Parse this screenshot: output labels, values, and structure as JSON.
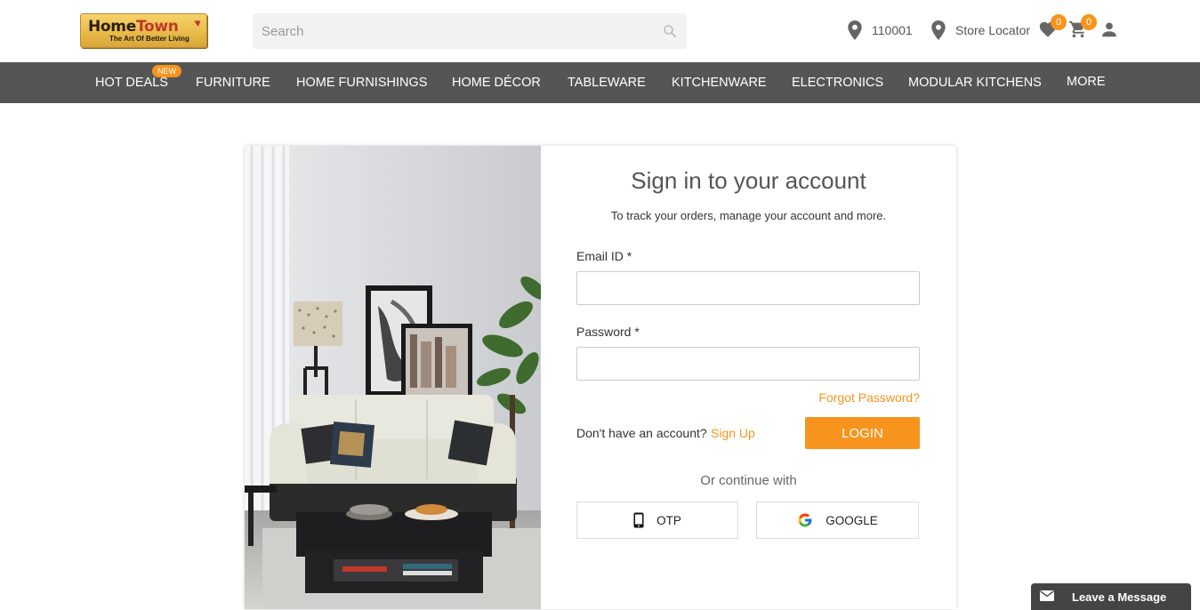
{
  "brand": {
    "name_part1": "Home",
    "name_part2": "Town",
    "tagline": "The Art Of Better Living"
  },
  "search": {
    "placeholder": "Search"
  },
  "header": {
    "pincode": "110001",
    "store_locator": "Store Locator",
    "wishlist_count": "0",
    "cart_count": "0"
  },
  "nav": {
    "items": [
      {
        "label": "HOT DEALS",
        "badge": "NEW"
      },
      {
        "label": "FURNITURE"
      },
      {
        "label": "HOME FURNISHINGS"
      },
      {
        "label": "HOME DÉCOR"
      },
      {
        "label": "TABLEWARE"
      },
      {
        "label": "KITCHENWARE"
      },
      {
        "label": "ELECTRONICS"
      },
      {
        "label": "MODULAR KITCHENS"
      },
      {
        "label": "MORE"
      }
    ]
  },
  "signin": {
    "title": "Sign in to your account",
    "subtitle": "To track your orders, manage your account and more.",
    "email_label": "Email ID *",
    "email_value": "",
    "password_label": "Password *",
    "password_value": "",
    "forgot": "Forgot Password?",
    "no_account": "Don't have an account?",
    "signup": "Sign Up",
    "login": "LOGIN",
    "or_continue": "Or continue with",
    "otp": "OTP",
    "google": "GOOGLE"
  },
  "chat": {
    "label": "Leave a Message"
  },
  "colors": {
    "accent": "#f7941d",
    "nav_bg": "#555555",
    "chat_bg": "#444444"
  },
  "icons": [
    "search-icon",
    "location-pin-icon",
    "heart-icon",
    "cart-icon",
    "user-icon",
    "phone-icon",
    "google-icon",
    "envelope-icon"
  ]
}
